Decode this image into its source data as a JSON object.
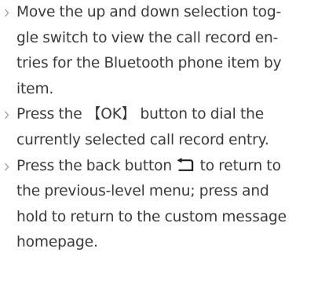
{
  "instructions": [
    {
      "lines": [
        "Move the up and down selection tog-",
        "gle switch to view the call record en-",
        "tries for the Bluetooth phone item by",
        "item."
      ]
    },
    {
      "lines": [
        "Press the 【OK】 button to dial the",
        "currently selected call record entry."
      ]
    },
    {
      "line1_before_icon": "Press the back button",
      "line1_after_icon": "to return to",
      "lines_rest": [
        "the previous-level menu; press and",
        "hold to return to the custom message",
        "homepage."
      ]
    }
  ],
  "icons": {
    "bullet": "chevron-right-icon",
    "back": "back-return-icon"
  },
  "colors": {
    "text": "#3a3a3a",
    "bullet": "#9a9a9a",
    "icon": "#1e1e1e"
  }
}
